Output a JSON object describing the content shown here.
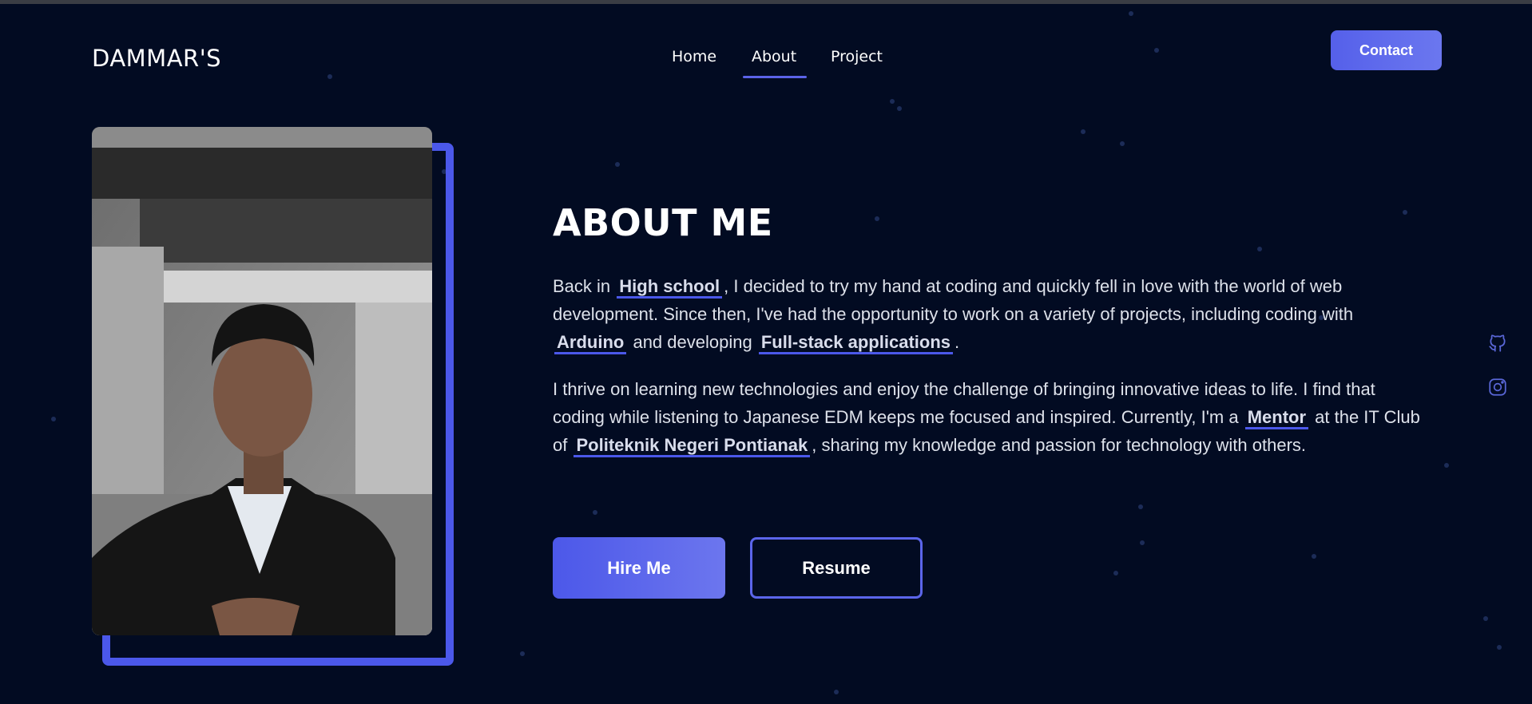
{
  "header": {
    "logo": "DAMMAR'S",
    "nav": [
      "Home",
      "About",
      "Project"
    ],
    "active_nav": "About",
    "contact_label": "Contact"
  },
  "about": {
    "title": "ABOUT ME",
    "para1": {
      "t1": "Back in",
      "hl1": "High school",
      "t2": ", I decided to try my hand at coding and quickly fell in love with the world of web development. Since then, I've had the opportunity to work on a variety of projects, including coding with",
      "hl2": "Arduino",
      "t3": "and developing",
      "hl3": "Full-stack applications",
      "t4": "."
    },
    "para2": {
      "t1": "I thrive on learning new technologies and enjoy the challenge of bringing innovative ideas to life. I find that coding while listening to Japanese EDM keeps me focused and inspired. Currently, I'm a",
      "hl1": "Mentor",
      "t2": "at the IT Club of",
      "hl2": "Politeknik Negeri Pontianak",
      "t3": ", sharing my knowledge and passion for technology with others."
    },
    "hire_label": "Hire Me",
    "resume_label": "Resume"
  },
  "social": {
    "icons": [
      "github-icon",
      "instagram-icon"
    ]
  },
  "colors": {
    "background": "#020b22",
    "accent": "#4b58ea",
    "text": "#dde1ea"
  }
}
